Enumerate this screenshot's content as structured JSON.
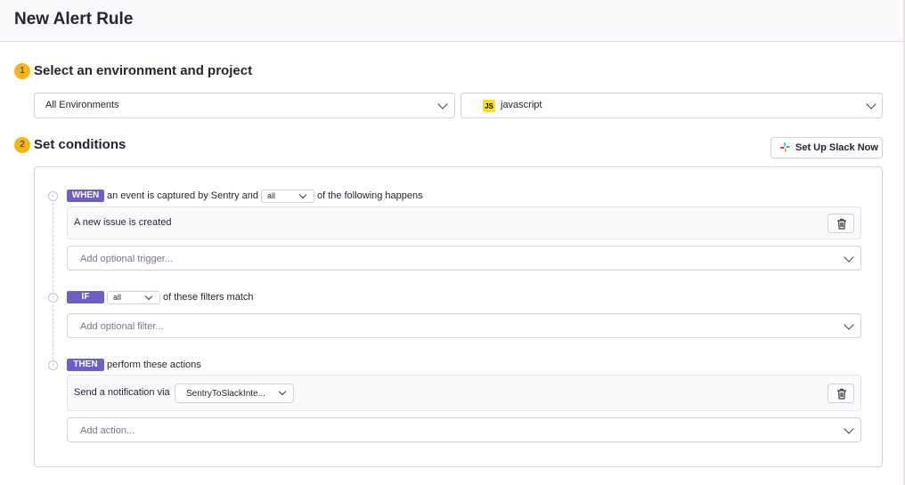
{
  "header": {
    "title": "New Alert Rule"
  },
  "steps": [
    {
      "number": "1",
      "title": "Select an environment and project"
    },
    {
      "number": "2",
      "title": "Set conditions"
    }
  ],
  "environment_select": {
    "value": "All Environments"
  },
  "project_select": {
    "value": "javascript",
    "icon_text": "JS"
  },
  "slack_button": {
    "label": "Set Up Slack Now",
    "icon": "slack-icon"
  },
  "when_section": {
    "badge": "WHEN",
    "text_before": "an event is captured by Sentry and",
    "match_value": "all",
    "text_after": "of the following happens",
    "trigger_item": "A new issue is created",
    "add_placeholder": "Add optional trigger..."
  },
  "if_section": {
    "badge": "IF",
    "match_value": "all",
    "text_after": "of these filters match",
    "add_placeholder": "Add optional filter..."
  },
  "then_section": {
    "badge": "THEN",
    "text_after": "perform these actions",
    "action_label": "Send a notification via",
    "action_value": "SentryToSlackInte...",
    "add_placeholder": "Add action..."
  },
  "colors": {
    "accent_purple": "#6c5fc7",
    "step_badge_yellow": "#f2b712",
    "js_yellow": "#f7df1e"
  }
}
